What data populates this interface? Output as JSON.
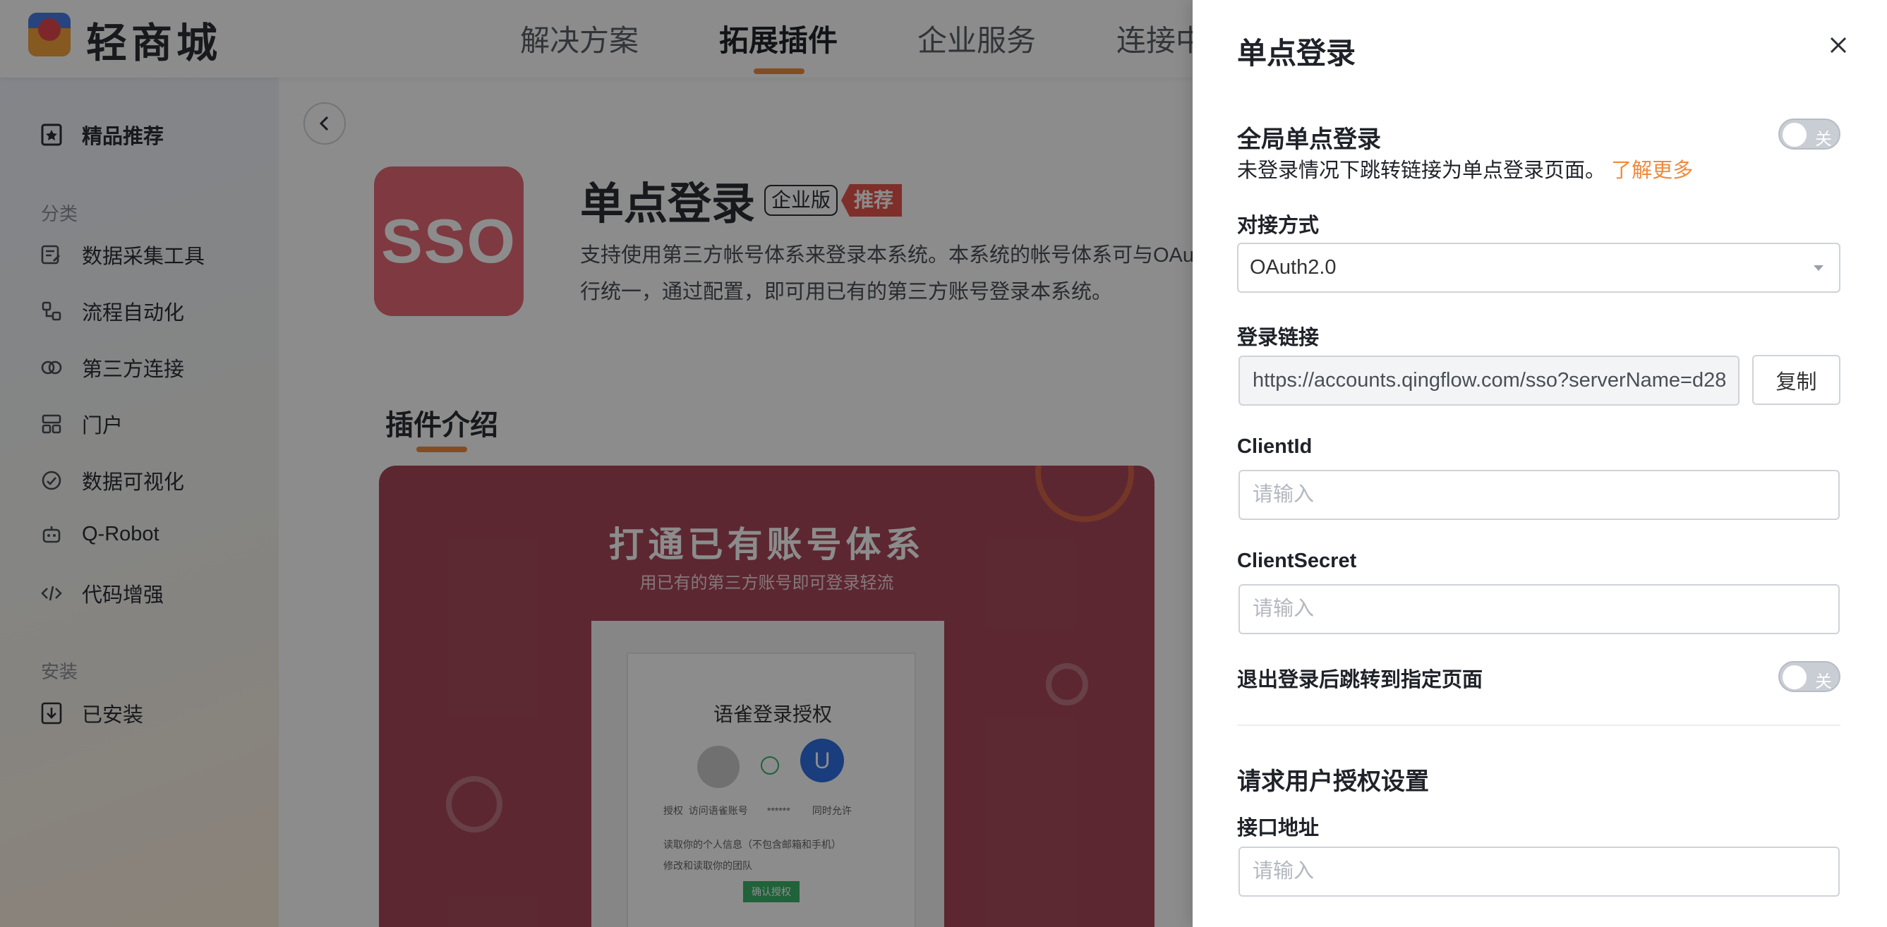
{
  "app": {
    "brand": "轻商城",
    "nav": [
      "解决方案",
      "拓展插件",
      "企业服务",
      "连接中"
    ]
  },
  "sidebar": {
    "featured": "精品推荐",
    "category_header": "分类",
    "items": [
      "数据采集工具",
      "流程自动化",
      "第三方连接",
      "门户",
      "数据可视化",
      "Q-Robot",
      "代码增强"
    ],
    "install_header": "安装",
    "installed": "已安装"
  },
  "plugin": {
    "logo_text": "SSO",
    "title": "单点登录",
    "badge_edition": "企业版",
    "badge_recommend": "推荐",
    "description_line1": "支持使用第三方帐号体系来登录本系统。本系统的帐号体系可与OAuth",
    "description_line2": "行统一，通过配置，即可用已有的第三方账号登录本系统。",
    "section_title": "插件介绍",
    "banner_title": "打通已有账号体系",
    "banner_subtitle": "用已有的第三方账号即可登录轻流",
    "mock_title": "语雀登录授权",
    "mock_avatar_letter": "U",
    "mock_row": "授权  访问语雀账号       ******        同时允许",
    "mock_check1": "读取你的个人信息（不包含邮箱和手机）",
    "mock_check2": "修改和读取你的团队",
    "mock_button": "确认授权"
  },
  "drawer": {
    "title": "单点登录",
    "global_sso_label": "全局单点登录",
    "global_sso_toggle": "关",
    "global_sso_desc": "未登录情况下跳转链接为单点登录页面。",
    "learn_more": "了解更多",
    "connect_method_label": "对接方式",
    "connect_method_value": "OAuth2.0",
    "login_link_label": "登录链接",
    "login_link_value": "https://accounts.qingflow.com/sso?serverName=d28",
    "copy_button": "复制",
    "client_id_label": "ClientId",
    "client_id_placeholder": "请输入",
    "client_secret_label": "ClientSecret",
    "client_secret_placeholder": "请输入",
    "logout_redirect_label": "退出登录后跳转到指定页面",
    "logout_redirect_toggle": "关",
    "user_auth_section": "请求用户授权设置",
    "api_address_label": "接口地址",
    "api_address_placeholder": "请输入"
  },
  "colors": {
    "accent": "#f08a3c",
    "sso_logo_bg": "#e66a76",
    "banner_bg": "#a8485a",
    "recommend_badge": "#e8574d"
  }
}
